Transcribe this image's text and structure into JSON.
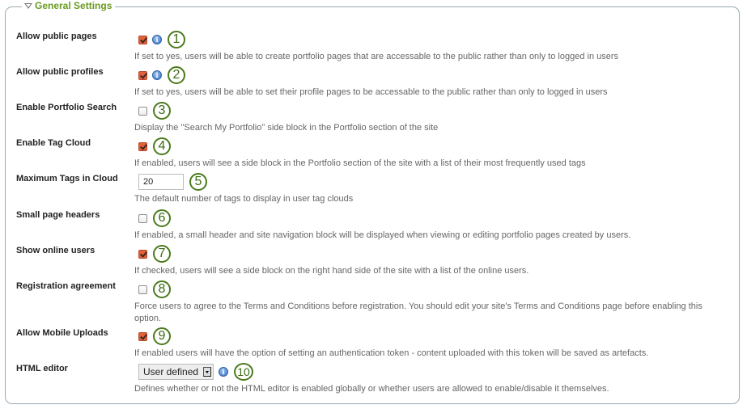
{
  "section": {
    "title": "General Settings",
    "collapse_icon": "triangle-down-icon"
  },
  "settings": [
    {
      "id": "allow_public_pages",
      "label": "Allow public pages",
      "type": "checkbox",
      "checked": true,
      "info": true,
      "callout": "1",
      "description": "If set to yes, users will be able to create portfolio pages that are accessable to the public rather than only to logged in users"
    },
    {
      "id": "allow_public_profiles",
      "label": "Allow public profiles",
      "type": "checkbox",
      "checked": true,
      "info": true,
      "callout": "2",
      "description": "If set to yes, users will be able to set their profile pages to be accessable to the public rather than only to logged in users"
    },
    {
      "id": "enable_portfolio_search",
      "label": "Enable Portfolio Search",
      "type": "checkbox",
      "checked": false,
      "info": false,
      "callout": "3",
      "description": "Display the \"Search My Portfolio\" side block in the Portfolio section of the site"
    },
    {
      "id": "enable_tag_cloud",
      "label": "Enable Tag Cloud",
      "type": "checkbox",
      "checked": true,
      "info": false,
      "callout": "4",
      "description": "If enabled, users will see a side block in the Portfolio section of the site with a list of their most frequently used tags"
    },
    {
      "id": "maximum_tags_in_cloud",
      "label": "Maximum Tags in Cloud",
      "type": "text",
      "value": "20",
      "info": false,
      "callout": "5",
      "description": "The default number of tags to display in user tag clouds"
    },
    {
      "id": "small_page_headers",
      "label": "Small page headers",
      "type": "checkbox",
      "checked": false,
      "info": false,
      "callout": "6",
      "description": "If enabled, a small header and site navigation block will be displayed when viewing or editing portfolio pages created by users."
    },
    {
      "id": "show_online_users",
      "label": "Show online users",
      "type": "checkbox",
      "checked": true,
      "info": false,
      "callout": "7",
      "description": "If checked, users will see a side block on the right hand side of the site with a list of the online users."
    },
    {
      "id": "registration_agreement",
      "label": "Registration agreement",
      "type": "checkbox",
      "checked": false,
      "info": false,
      "callout": "8",
      "description": "Force users to agree to the Terms and Conditions before registration. You should edit your site's Terms and Conditions page before enabling this option."
    },
    {
      "id": "allow_mobile_uploads",
      "label": "Allow Mobile Uploads",
      "type": "checkbox",
      "checked": true,
      "info": false,
      "callout": "9",
      "description": "If enabled users will have the option of setting an authentication token - content uploaded with this token will be saved as artefacts."
    },
    {
      "id": "html_editor",
      "label": "HTML editor",
      "type": "select",
      "value": "User defined",
      "info": true,
      "callout": "10",
      "description": "Defines whether or not the HTML editor is enabled globally or whether users are allowed to enable/disable it themselves."
    }
  ],
  "info_icon_glyph": "i",
  "colors": {
    "section_title": "#6a9a1f",
    "checkbox_checked": "#e0613a",
    "callout_ring": "#4b7a1c",
    "info_icon": "#3a72c4",
    "border": "#98aab3"
  }
}
